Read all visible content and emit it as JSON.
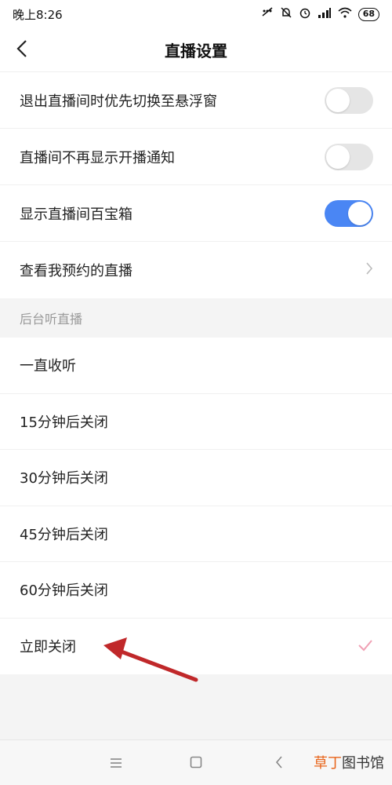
{
  "status_bar": {
    "time": "晚上8:26",
    "battery": "68"
  },
  "header": {
    "title": "直播设置"
  },
  "settings": [
    {
      "label": "退出直播间时优先切换至悬浮窗",
      "type": "toggle",
      "on": false
    },
    {
      "label": "直播间不再显示开播通知",
      "type": "toggle",
      "on": false
    },
    {
      "label": "显示直播间百宝箱",
      "type": "toggle",
      "on": true
    },
    {
      "label": "查看我预约的直播",
      "type": "link"
    }
  ],
  "section": {
    "title": "后台听直播"
  },
  "options": [
    {
      "label": "一直收听",
      "selected": false
    },
    {
      "label": "15分钟后关闭",
      "selected": false
    },
    {
      "label": "30分钟后关闭",
      "selected": false
    },
    {
      "label": "45分钟后关闭",
      "selected": false
    },
    {
      "label": "60分钟后关闭",
      "selected": false
    },
    {
      "label": "立即关闭",
      "selected": true
    }
  ],
  "colors": {
    "toggle_on": "#4a86f4",
    "check": "#f0a0b4",
    "annotation_arrow": "#c0282a"
  },
  "watermark": {
    "accent": "草丁",
    "rest": "图书馆"
  }
}
